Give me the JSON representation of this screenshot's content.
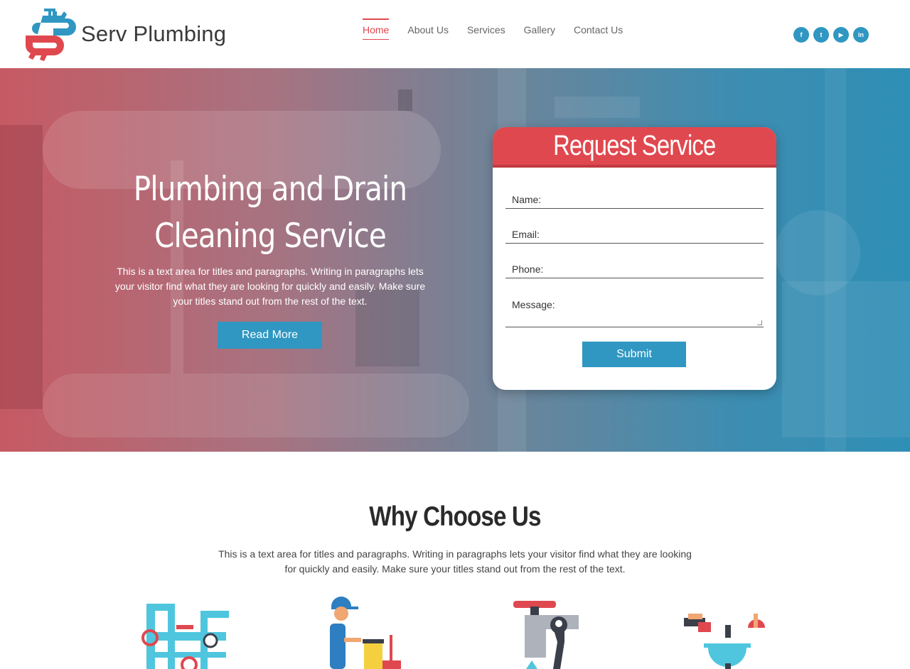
{
  "header": {
    "logo_text": "Serv Plumbing",
    "nav": [
      {
        "label": "Home",
        "active": true
      },
      {
        "label": "About Us",
        "active": false
      },
      {
        "label": "Services",
        "active": false
      },
      {
        "label": "Gallery",
        "active": false
      },
      {
        "label": "Contact Us",
        "active": false
      }
    ],
    "social": [
      {
        "icon": "facebook-icon",
        "glyph": "f"
      },
      {
        "icon": "twitter-icon",
        "glyph": "t"
      },
      {
        "icon": "youtube-icon",
        "glyph": "▶"
      },
      {
        "icon": "linkedin-icon",
        "glyph": "in"
      }
    ]
  },
  "hero": {
    "title_line1": "Plumbing and Drain",
    "title_line2": "Cleaning Service",
    "text": "This is a text area for titles and paragraphs. Writing in paragraphs lets your visitor find what they are looking for quickly and easily. Make sure your titles stand out from the rest of the text.",
    "button": "Read More"
  },
  "form": {
    "title": "Request Service",
    "name_label": "Name:",
    "email_label": "Email:",
    "phone_label": "Phone:",
    "message_label": "Message:",
    "submit": "Submit"
  },
  "why": {
    "title": "Why Choose Us",
    "text": "This is a text area for titles and paragraphs. Writing in paragraphs lets your visitor find what they are looking for quickly and easily. Make sure your titles stand out from the rest of the text."
  },
  "colors": {
    "accent_red": "#e0484f",
    "accent_blue": "#2f97c1"
  }
}
